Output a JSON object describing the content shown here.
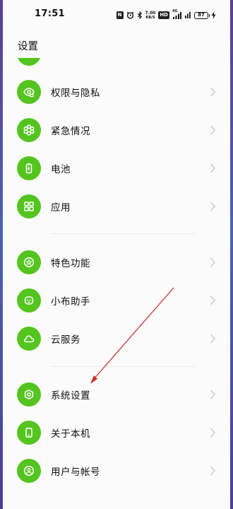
{
  "status_bar": {
    "time": "17:51",
    "nfc": "N",
    "speed_top": "7.00",
    "speed_bottom": "KB/S",
    "hd": "HD",
    "signal_label": "4G",
    "battery": "87"
  },
  "page": {
    "title": "设置"
  },
  "colors": {
    "icon_green": "#54c41f",
    "annotation_arrow": "#c9342c"
  },
  "settings_items": [
    {
      "label": "权限与隐私",
      "icon": "privacy-eye-icon"
    },
    {
      "label": "紧急情况",
      "icon": "emergency-asterisk-icon"
    },
    {
      "label": "电池",
      "icon": "battery-icon"
    },
    {
      "label": "应用",
      "icon": "apps-grid-icon"
    },
    {
      "label": "特色功能",
      "icon": "star-icon"
    },
    {
      "label": "小布助手",
      "icon": "assistant-icon"
    },
    {
      "label": "云服务",
      "icon": "cloud-icon"
    },
    {
      "label": "系统设置",
      "icon": "hexagon-gear-icon"
    },
    {
      "label": "关于本机",
      "icon": "phone-icon"
    },
    {
      "label": "用户与帐号",
      "icon": "user-icon"
    }
  ]
}
